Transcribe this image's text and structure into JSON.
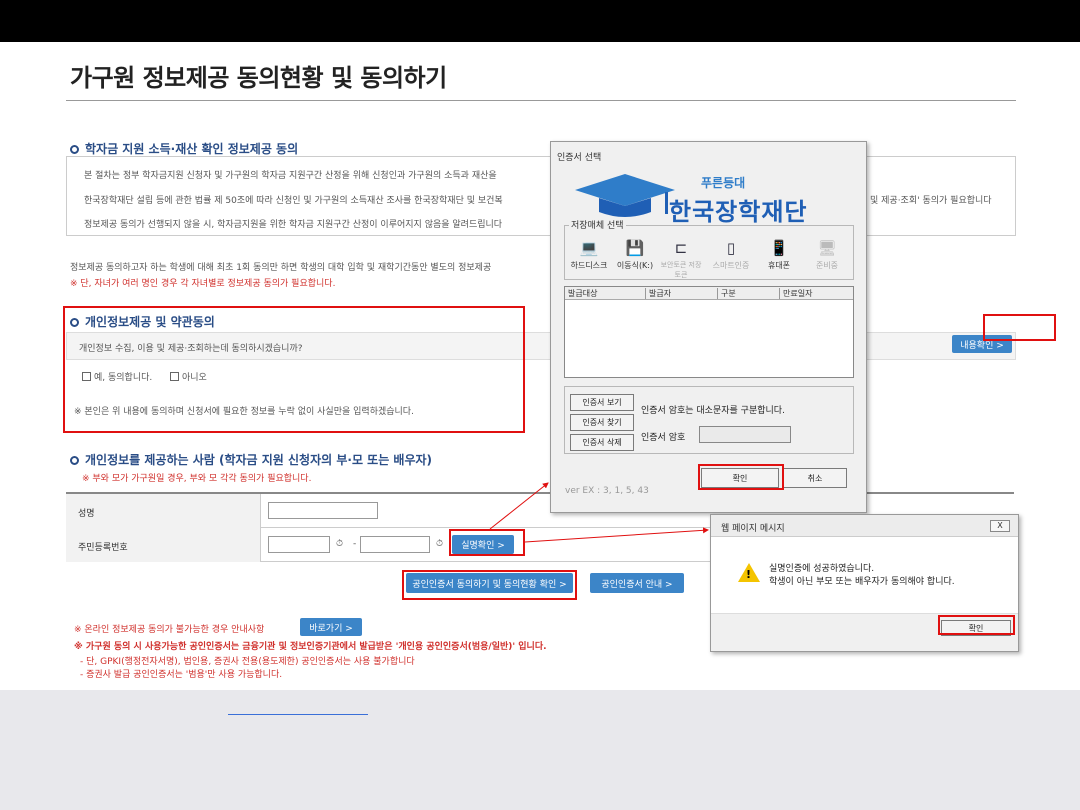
{
  "page": {
    "title": "가구원 정보제공 동의현황 및 동의하기"
  },
  "section1": {
    "title": "학자금 지원 소득·재산 확인 정보제공 동의",
    "line1": "본 절차는 정부 학자금지원 신청자 및 가구원의 학자금 지원구간 산정을 위해 신청인과 가구원의 소득과 재산을",
    "line2": "한국장학재단 설립 등에 관한 법률 제 50조에 따라 신청인 및 가구원의 소득재산 조사를 한국장학재단 및 보건복",
    "line2_tail": "및 제공·조회' 동의가 필요합니다",
    "line3": "정보제공 동의가 선행되지 않을 시, 학자금지원을 위한 학자금 지원구간 산정이 이루어지지 않음을 알려드립니다",
    "note1": "정보제공 동의하고자 하는 학생에 대해 최초 1회 동의만 하면 학생의 대학 입학 및 재학기간동안 별도의 정보제공",
    "note2": "※ 단, 자녀가 여러 명인 경우 각 자녀별로 정보제공 동의가 필요합니다."
  },
  "section2": {
    "title": "개인정보제공 및 약관동의",
    "question": "개인정보 수집, 이용 및 제공·조회하는데 동의하시겠습니까?",
    "agree": "예, 동의합니다.",
    "disagree": "아니오",
    "notice": "※ 본인은 위 내용에 동의하며 신청서에 필요한 정보를 누락 없이 사실만을 입력하겠습니다.",
    "detail_button": "내용확인 >"
  },
  "section3": {
    "title": "개인정보를 제공하는 사람 (학자금 지원 신청자의 부·모 또는 배우자)",
    "sub": "※ 부와 모가 가구원일 경우, 부와 모 각각 동의가 필요합니다.",
    "name_label": "성명",
    "rrn_label": "주민등록번호",
    "rrn_dash": "-",
    "verify_button": "실명확인 >",
    "consent_button": "공인인증서 동의하기 및 동의현황 확인 >",
    "guide_button": "공인인증서 안내 >"
  },
  "footer_notes": {
    "line1": "※ 온라인 정보제공 동의가 불가능한 경우 안내사항",
    "goto_button": "바로가기 >",
    "line2": "※ 가구원 동의 시 사용가능한 공인인증서는 금융기관 및 정보인증기관에서 발급받은 '개인용 공인인증서(범용/일반)' 입니다.",
    "line3": "- 단, GPKI(행정전자서명), 법인용, 증권사 전용(용도제한) 공인인증서는 사용 불가합니다",
    "line4": "- 증권사 발급 공인인증서는 '범용'만 사용 가능합니다."
  },
  "cert_dialog": {
    "title": "인증서 선택",
    "slogan": "푸른등대",
    "org_name": "한국장학재단",
    "storage_legend": "저장매체 선택",
    "media": [
      {
        "label": "하드디스크",
        "icon": "hard-disk-icon",
        "glyph": "💻"
      },
      {
        "label": "이동식(K:)",
        "icon": "removable-drive-icon",
        "glyph": "💾"
      },
      {
        "label": "보안토큰 저장토큰",
        "icon": "security-token-icon",
        "glyph": "⊏"
      },
      {
        "label": "스마트인증",
        "icon": "smart-auth-icon",
        "glyph": "▯"
      },
      {
        "label": "휴대폰",
        "icon": "mobile-phone-icon",
        "glyph": "📱"
      },
      {
        "label": "준비중",
        "icon": "pending-icon",
        "glyph": "🖥"
      }
    ],
    "columns": [
      "발급대상",
      "발급자",
      "구분",
      "만료일자"
    ],
    "view_button": "인증서 보기",
    "find_button": "인증서 찾기",
    "delete_button": "인증서 삭제",
    "case_notice": "인증서 암호는 대소문자를 구분합니다.",
    "password_label": "인증서 암호",
    "ok_button": "확인",
    "cancel_button": "취소",
    "version": "ver EX : 3, 1, 5, 43"
  },
  "msg_dialog": {
    "title": "웹 페이지 메시지",
    "close": "X",
    "line1": "실명인증에 성공하였습니다.",
    "line2": "학생이 아닌 부모 또는 배우자가 동의해야 합니다.",
    "ok_button": "확인"
  },
  "colors": {
    "header_bar": "#000000",
    "accent_blue": "#3c85c8",
    "highlight_red": "#e01010",
    "footer_band": "#e8e8ec"
  }
}
